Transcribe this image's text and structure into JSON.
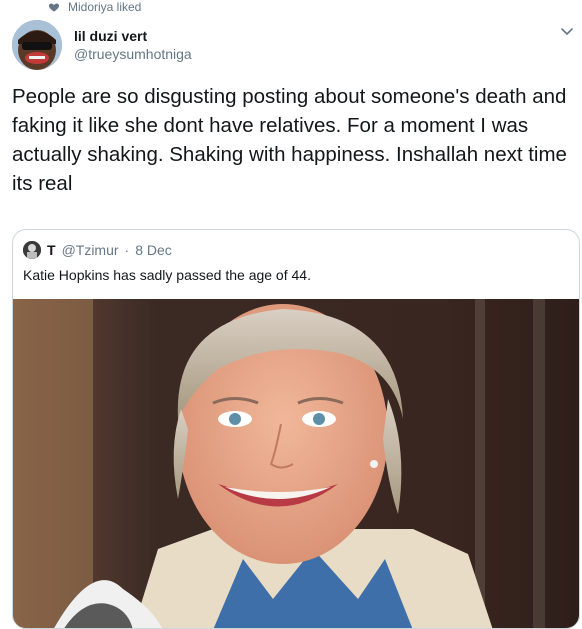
{
  "social_context": {
    "text": "Midoriya liked",
    "icon": "heart-icon"
  },
  "tweet": {
    "author_name": "lil duzi vert",
    "author_handle": "@trueysumhotniga",
    "text": "People are so disgusting posting about someone's death and faking it like she dont have relatives. For a moment I was actually shaking. Shaking with happiness. Inshallah next time its real",
    "menu_icon": "chevron-down-icon"
  },
  "quoted_tweet": {
    "author_name": "T",
    "author_handle": "@Tzimur",
    "separator": "·",
    "date": "8 Dec",
    "text": "Katie Hopkins has sadly passed the age of 44.",
    "media": "photo of a smiling woman with short blonde hair"
  },
  "colors": {
    "text": "#14171a",
    "secondary": "#657786",
    "border": "#ccd6dd"
  }
}
